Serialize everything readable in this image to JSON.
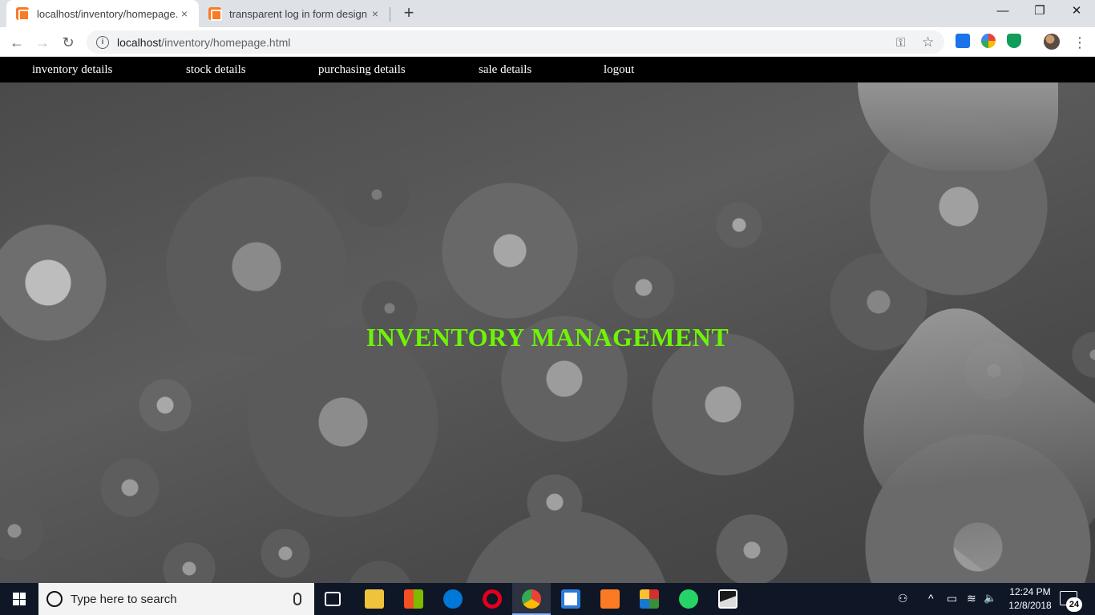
{
  "browser": {
    "tabs": [
      {
        "title": "localhost/inventory/homepage.h",
        "close": "×",
        "active": true
      },
      {
        "title": "transparent log in form design",
        "close": "×",
        "active": false
      }
    ],
    "new_tab": "+",
    "window_controls": {
      "minimize": "—",
      "maximize": "❐",
      "close": "✕"
    },
    "nav": {
      "back": "←",
      "forward": "→",
      "reload": "↻"
    },
    "address": {
      "host": "localhost",
      "path": "/inventory/homepage.html",
      "info_icon": "i"
    },
    "omnibox_icons": {
      "key": "⚿",
      "star": "☆"
    },
    "menu": "⋮"
  },
  "page": {
    "nav_links": [
      "inventory details",
      "stock details",
      "purchasing details",
      "sale details",
      "logout"
    ],
    "title": "INVENTORY MANAGEMENT",
    "title_color": "#6ef407",
    "background_image": "water-droplets-grayscale"
  },
  "taskbar": {
    "search_placeholder": "Type here to search",
    "time": "12:24 PM",
    "date": "12/8/2018",
    "notifications": "24",
    "apps": [
      "task-view",
      "file-explorer",
      "microsoft-store",
      "edge",
      "opera",
      "chrome",
      "brackets",
      "xampp",
      "winrar",
      "whatsapp",
      "photos"
    ],
    "tray": {
      "people": "⚇",
      "chevron": "^",
      "battery": "▭",
      "wifi": "≋",
      "volume": "🔈"
    }
  }
}
